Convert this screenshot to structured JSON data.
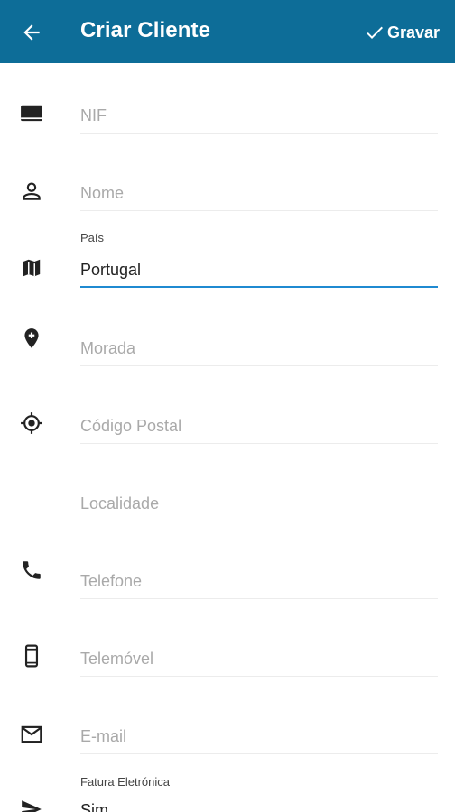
{
  "appbar": {
    "title": "Criar Cliente",
    "save_label": "Gravar",
    "color": "#0d6d98"
  },
  "fields": {
    "nif": {
      "placeholder": "NIF",
      "icon": "id-card-icon"
    },
    "nome": {
      "placeholder": "Nome",
      "icon": "person-icon"
    },
    "pais": {
      "label": "País",
      "value": "Portugal",
      "icon": "map-icon"
    },
    "morada": {
      "placeholder": "Morada",
      "icon": "add-location-icon"
    },
    "codigo_postal": {
      "placeholder": "Código Postal",
      "icon": "gps-target-icon"
    },
    "localidade": {
      "placeholder": "Localidade"
    },
    "telefone": {
      "placeholder": "Telefone",
      "icon": "phone-icon"
    },
    "telemovel": {
      "placeholder": "Telemóvel",
      "icon": "smartphone-icon"
    },
    "email": {
      "placeholder": "E-mail",
      "icon": "mail-icon"
    },
    "fatura": {
      "label": "Fatura Eletrónica",
      "value": "Sim",
      "icon": "send-icon"
    }
  }
}
